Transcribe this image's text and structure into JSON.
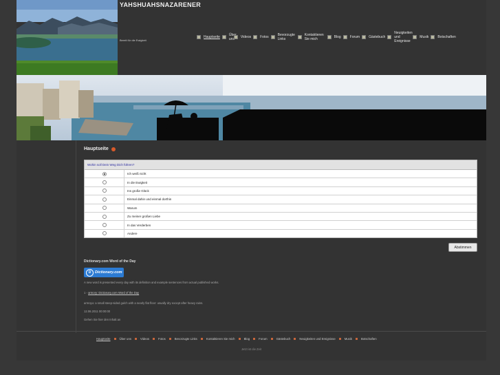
{
  "site": {
    "title": "YAHSHUAHSNAZARENER",
    "tagline": "Bereit für die Ewigkeit"
  },
  "nav": {
    "items": [
      {
        "label": "Hauptseite",
        "active": true
      },
      {
        "label": "Über uns"
      },
      {
        "label": "Videos"
      },
      {
        "label": "Fotos"
      },
      {
        "label": "Bevorzugte Links"
      },
      {
        "label": "Kontaktieren Sie mich"
      },
      {
        "label": "Blog"
      },
      {
        "label": "Forum"
      },
      {
        "label": "Gästebuch"
      },
      {
        "label": "Neuigkeiten und Ereignisse"
      },
      {
        "label": "Musik"
      },
      {
        "label": "Botschaften"
      }
    ]
  },
  "page": {
    "heading": "Hauptseite"
  },
  "poll": {
    "question": "Wohin soll Dein Weg Dich führen?",
    "options": [
      {
        "label": "Ich weiß nicht",
        "selected": true
      },
      {
        "label": "In die Ewigkeit"
      },
      {
        "label": "Ins große Glück"
      },
      {
        "label": "Einmal dahin und einmal dorthin"
      },
      {
        "label": "Warum"
      },
      {
        "label": "Zu meiner großen Liebe"
      },
      {
        "label": "In das Verderben"
      },
      {
        "label": "Andere"
      }
    ],
    "vote_label": "Abstimmen"
  },
  "wotd": {
    "heading": "Dictionary.com Word of the Day",
    "logo_text": "Dictionary.com",
    "intro": "A new word is presented every day with its definition and example sentences from actual published works.",
    "entry_prefix": "1 - ",
    "entry_link": "armorу: Dictionary.com Word of the Day",
    "definition": "armoyu: a small steep-sided gulch with a nearly flat floor: usually dry except after heavy rains.",
    "date": "12.06.2011 00:00:00",
    "link_more": "Gehen Sie hier den Inhalt an"
  },
  "footer": {
    "note": "Jetzt ist die Zeit"
  },
  "colors": {
    "background": "#373737",
    "accent": "#c8663c",
    "link": "#2a2aa0",
    "dictionary_blue": "#2c7bd3"
  }
}
